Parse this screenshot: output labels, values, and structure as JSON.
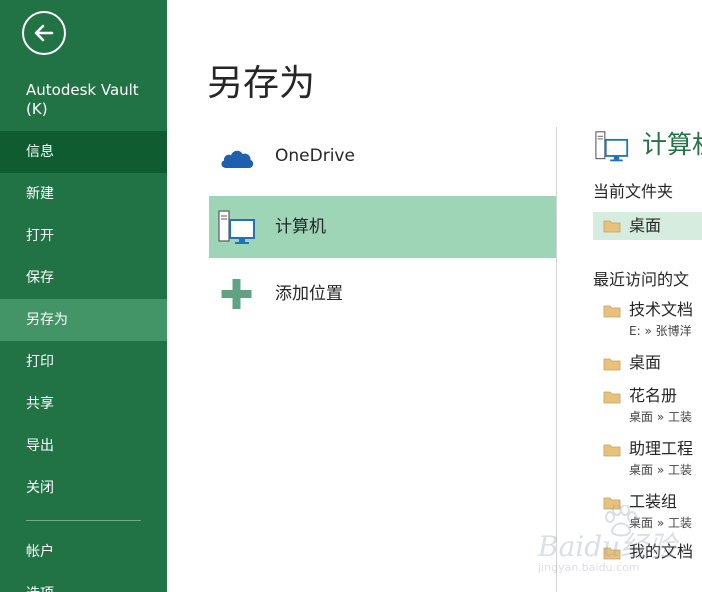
{
  "sidebar": {
    "app_name": "Autodesk Vault (K)",
    "items": [
      {
        "label": "信息",
        "state": "dark"
      },
      {
        "label": "新建",
        "state": ""
      },
      {
        "label": "打开",
        "state": ""
      },
      {
        "label": "保存",
        "state": ""
      },
      {
        "label": "另存为",
        "state": "active"
      },
      {
        "label": "打印",
        "state": ""
      },
      {
        "label": "共享",
        "state": ""
      },
      {
        "label": "导出",
        "state": ""
      },
      {
        "label": "关闭",
        "state": ""
      }
    ],
    "items_bottom": [
      {
        "label": "帐户"
      },
      {
        "label": "选项"
      }
    ],
    "colors": {
      "background": "#217346",
      "dark": "#0e5c2f",
      "active": "#439467"
    }
  },
  "main": {
    "title": "另存为",
    "locations": [
      {
        "label": "OneDrive",
        "icon": "cloud-icon",
        "selected": false
      },
      {
        "label": "计算机",
        "icon": "computer-icon",
        "selected": true
      },
      {
        "label": "添加位置",
        "icon": "plus-icon",
        "selected": false
      }
    ]
  },
  "right_panel": {
    "title": "计算机",
    "current_folder_title": "当前文件夹",
    "current_folder": {
      "name": "桌面"
    },
    "recent_title": "最近访问的文",
    "recent": [
      {
        "name": "技术文档",
        "path": "E: » 张博洋"
      },
      {
        "name": "桌面",
        "path": ""
      },
      {
        "name": "花名册",
        "path": "桌面 » 工装"
      },
      {
        "name": "助理工程",
        "path": "桌面 » 工装"
      },
      {
        "name": "工装组",
        "path": "桌面 » 工装"
      },
      {
        "name": "我的文档",
        "path": ""
      }
    ]
  },
  "watermark": {
    "text": "Baidu经验",
    "url": "jingyan.baidu.com"
  }
}
